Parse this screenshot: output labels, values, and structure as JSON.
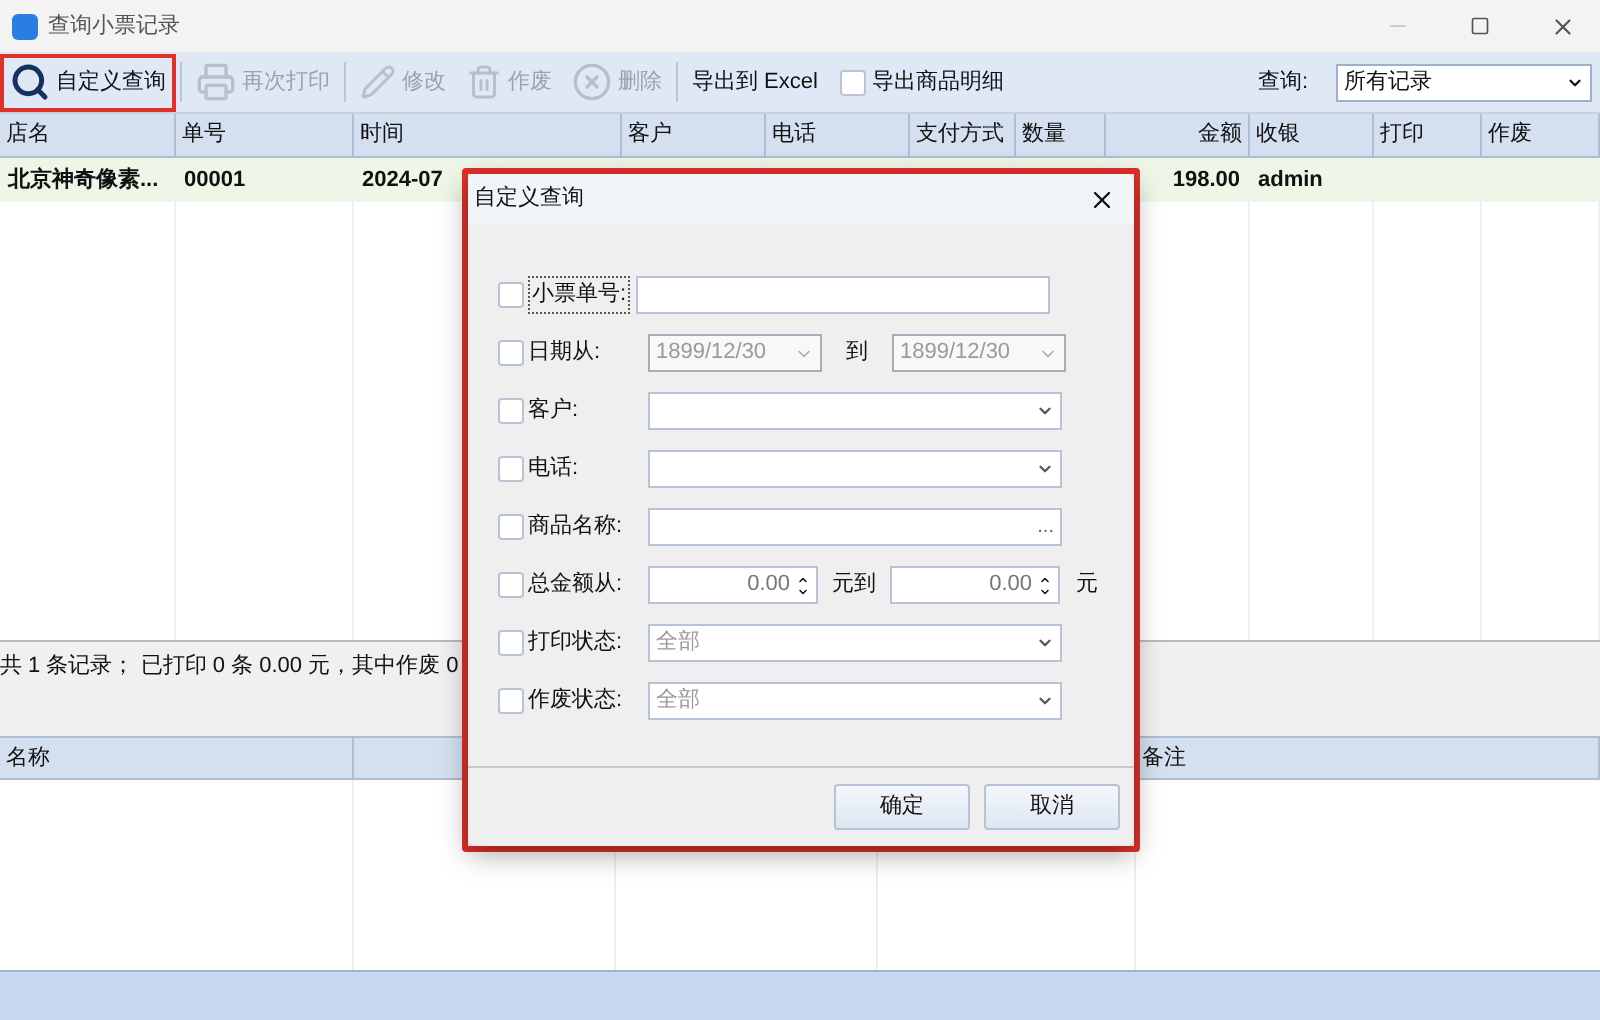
{
  "window": {
    "title": "查询小票记录"
  },
  "toolbar": {
    "buttons": [
      {
        "label": "自定义查询",
        "disabled": false,
        "highlighted": true
      },
      {
        "label": "再次打印",
        "disabled": true,
        "highlighted": false
      },
      {
        "label": "修改",
        "disabled": true,
        "highlighted": false
      },
      {
        "label": "作废",
        "disabled": true,
        "highlighted": false
      },
      {
        "label": "删除",
        "disabled": true,
        "highlighted": false
      },
      {
        "label": "导出到 Excel",
        "disabled": false,
        "highlighted": false
      }
    ],
    "export_detail": {
      "label": "导出商品明细",
      "checked": false
    },
    "query": {
      "label": "查询:",
      "value": "所有记录"
    }
  },
  "table": {
    "columns": [
      "店名",
      "单号",
      "时间",
      "客户",
      "电话",
      "支付方式",
      "数量",
      "金额",
      "收银",
      "打印",
      "作废"
    ],
    "rows": [
      {
        "selected": true,
        "cells": [
          "北京神奇像素...",
          "00001",
          "2024-07",
          "",
          "",
          "",
          "",
          "198.00",
          "admin",
          "",
          ""
        ]
      }
    ]
  },
  "summary": "共 1 条记录；  已打印 0 条 0.00 元，其中作废 0",
  "detail_table": {
    "columns": [
      "名称",
      "备注"
    ]
  },
  "dialog": {
    "title": "自定义查询",
    "highlighted": true,
    "fields": [
      {
        "kind": "text",
        "label": "小票单号:",
        "checked": false,
        "focused": true
      },
      {
        "kind": "daterange",
        "label": "日期从:",
        "checked": false,
        "from": "1899/12/30",
        "between": "到",
        "to": "1899/12/30"
      },
      {
        "kind": "combo",
        "label": "客户:",
        "checked": false
      },
      {
        "kind": "combo",
        "label": "电话:",
        "checked": false
      },
      {
        "kind": "picker",
        "label": "商品名称:",
        "checked": false,
        "button": "..."
      },
      {
        "kind": "amount",
        "label": "总金额从:",
        "checked": false,
        "from": "0.00",
        "between": "元到",
        "to": "0.00",
        "unit": "元"
      },
      {
        "kind": "combo",
        "label": "打印状态:",
        "checked": false,
        "value": "全部"
      },
      {
        "kind": "combo",
        "label": "作废状态:",
        "checked": false,
        "value": "全部"
      }
    ],
    "buttons": [
      "确定",
      "取消"
    ]
  }
}
